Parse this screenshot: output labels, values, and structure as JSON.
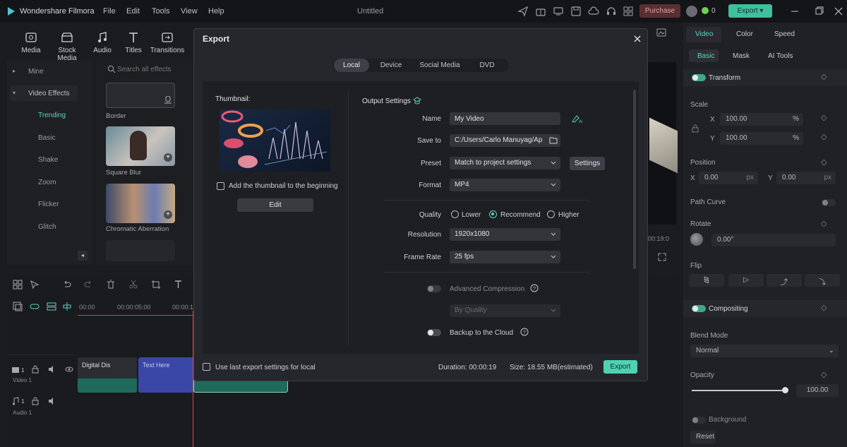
{
  "app": {
    "name": "Wondershare Filmora",
    "doc_title": "Untitled",
    "purchase": "Purchase",
    "badge_count": "0",
    "export": "Export"
  },
  "menu": [
    "File",
    "Edit",
    "Tools",
    "View",
    "Help"
  ],
  "tools": [
    "Media",
    "Stock Media",
    "Audio",
    "Titles",
    "Transitions"
  ],
  "categories": {
    "mine": "Mine",
    "video_effects": "Video Effects",
    "subs": [
      "Trending",
      "Basic",
      "Shake",
      "Zoom",
      "Flicker",
      "Glitch"
    ]
  },
  "search": {
    "placeholder": "Search all effects"
  },
  "effects": [
    "Border",
    "Square Blur",
    "Chromatic Aberration"
  ],
  "timeline": {
    "times": [
      "00:00",
      "00:00:05:00",
      "00:00:1"
    ],
    "clips": [
      "Digital Dis",
      "Text Here"
    ],
    "tracks": [
      "Video 1",
      "Audio 1"
    ],
    "preview_time": "00:19:0"
  },
  "right_panel": {
    "tabs": [
      "Video",
      "Color",
      "Speed"
    ],
    "subtabs": [
      "Basic",
      "Mask",
      "AI Tools"
    ],
    "transform": "Transform",
    "scale": "Scale",
    "x_label": "X",
    "y_label": "Y",
    "scale_x": "100.00",
    "scale_y": "100.00",
    "pct": "%",
    "position": "Position",
    "pos_x": "0.00",
    "pos_y": "0.00",
    "px": "px",
    "path_curve": "Path Curve",
    "rotate": "Rotate",
    "rotate_val": "0.00°",
    "flip": "Flip",
    "compositing": "Compositing",
    "blend_mode": "Blend Mode",
    "blend_val": "Normal",
    "opacity": "Opacity",
    "opacity_val": "100.00",
    "opacity_level": 1.0,
    "background": "Background",
    "reset": "Reset"
  },
  "export_dialog": {
    "title": "Export",
    "tabs": [
      "Local",
      "Device",
      "Social Media",
      "DVD"
    ],
    "thumbnail_label": "Thumbnail:",
    "add_thumb": "Add the thumbnail to the beginning",
    "edit": "Edit",
    "output_settings": "Output Settings",
    "name_label": "Name",
    "name_value": "My Video",
    "save_label": "Save to",
    "save_value": "C:/Users/Carlo Manuyag/Ap",
    "preset_label": "Preset",
    "preset_value": "Match to project settings",
    "settings": "Settings",
    "format_label": "Format",
    "format_value": "MP4",
    "quality_label": "Quality",
    "quality_options": [
      "Lower",
      "Recommend",
      "Higher"
    ],
    "resolution_label": "Resolution",
    "resolution_value": "1920x1080",
    "framerate_label": "Frame Rate",
    "framerate_value": "25 fps",
    "adv_compression": "Advanced Compression",
    "by_quality": "By Quality",
    "backup": "Backup to the Cloud",
    "use_last": "Use last export settings for local",
    "duration": "Duration: 00:00:19",
    "size": "Size: 18.55 MB(estimated)",
    "export": "Export"
  },
  "colors": {
    "accent": "#58d6c0",
    "export_btn": "#3fbf9f",
    "purchase": "#5a2f33"
  }
}
